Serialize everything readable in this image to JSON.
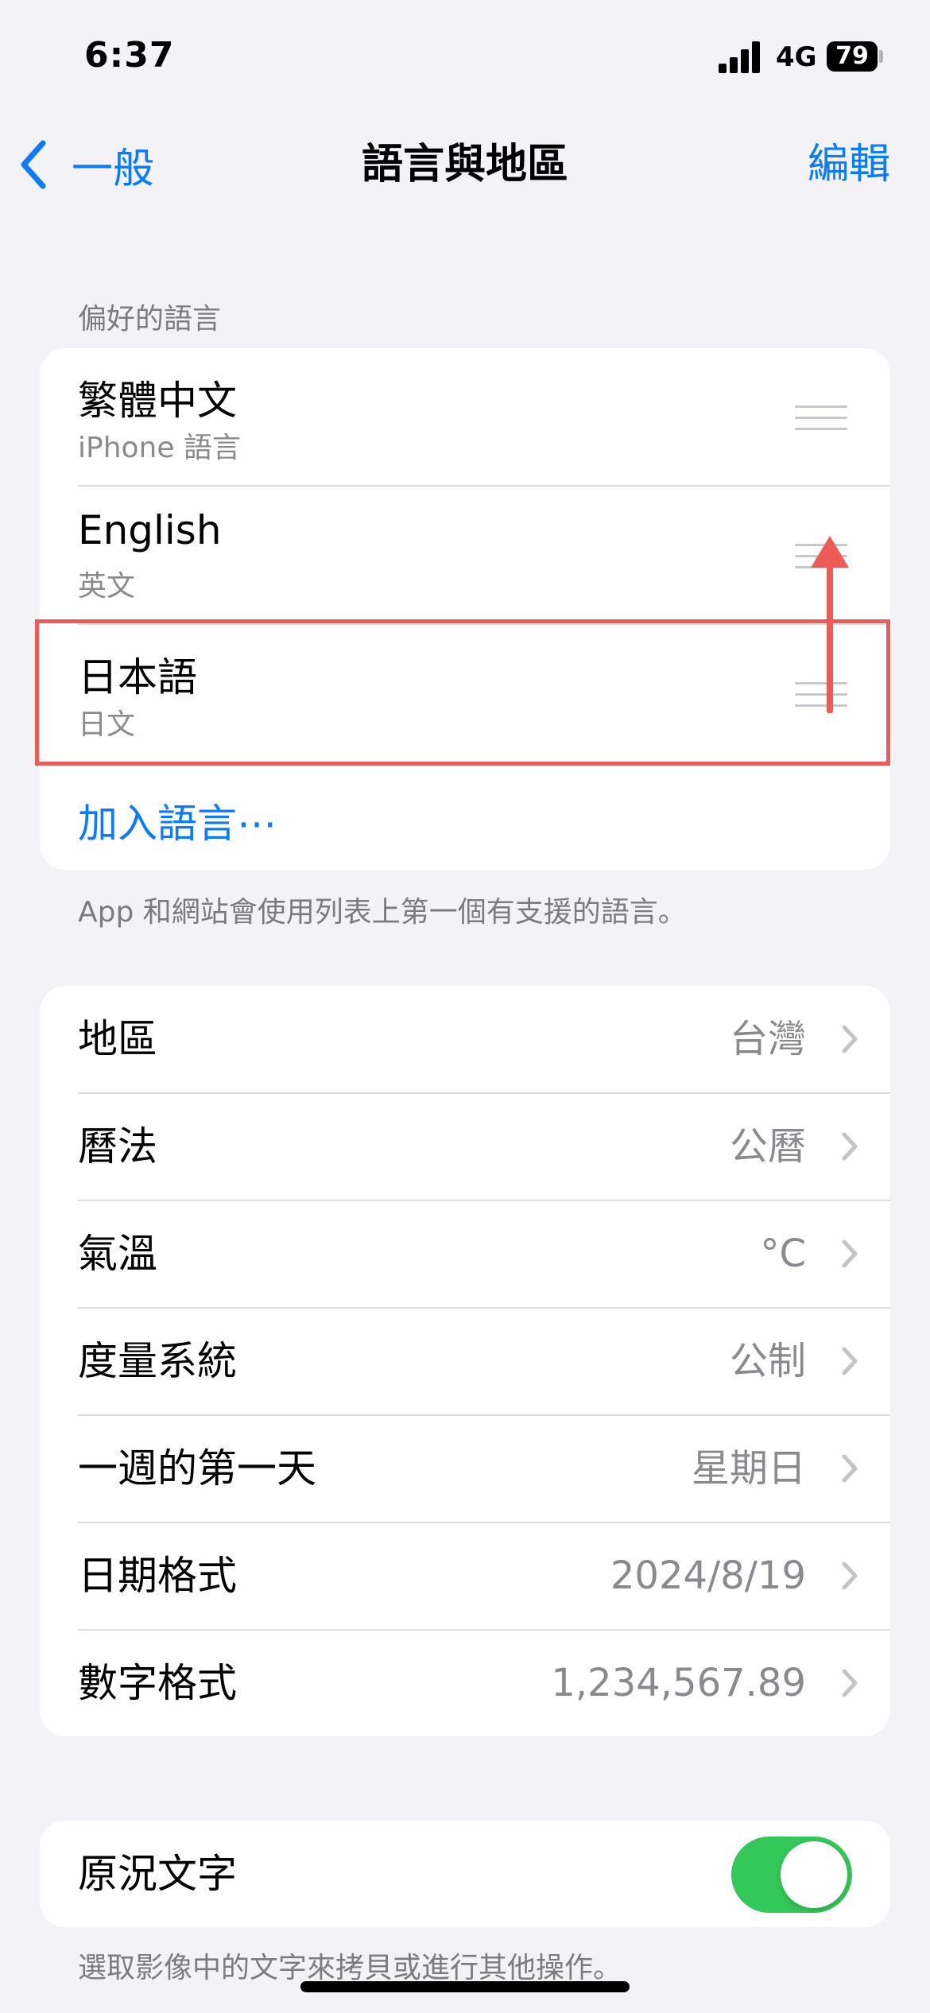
{
  "status_bar": {
    "time": "6:37",
    "network": "4G",
    "battery": "79"
  },
  "nav": {
    "back_label": "一般",
    "title": "語言與地區",
    "edit_label": "編輯"
  },
  "preferred_languages": {
    "header": "偏好的語言",
    "items": [
      {
        "title": "繁體中文",
        "subtitle": "iPhone 語言"
      },
      {
        "title": "English",
        "subtitle": "英文"
      },
      {
        "title": "日本語",
        "subtitle": "日文"
      }
    ],
    "add_label": "加入語言⋯",
    "footer": "App 和網站會使用列表上第一個有支援的語言。"
  },
  "region_settings": {
    "items": [
      {
        "label": "地區",
        "value": "台灣"
      },
      {
        "label": "曆法",
        "value": "公曆"
      },
      {
        "label": "氣溫",
        "value": "°C"
      },
      {
        "label": "度量系統",
        "value": "公制"
      },
      {
        "label": "一週的第一天",
        "value": "星期日"
      },
      {
        "label": "日期格式",
        "value": "2024/8/19"
      },
      {
        "label": "數字格式",
        "value": "1,234,567.89"
      }
    ]
  },
  "live_text": {
    "label": "原況文字",
    "enabled": true,
    "footer": "選取影像中的文字來拷貝或進行其他操作。"
  },
  "colors": {
    "accent": "#0a7aff",
    "toggle_on": "#34c759",
    "annotation": "#ec5b55"
  }
}
